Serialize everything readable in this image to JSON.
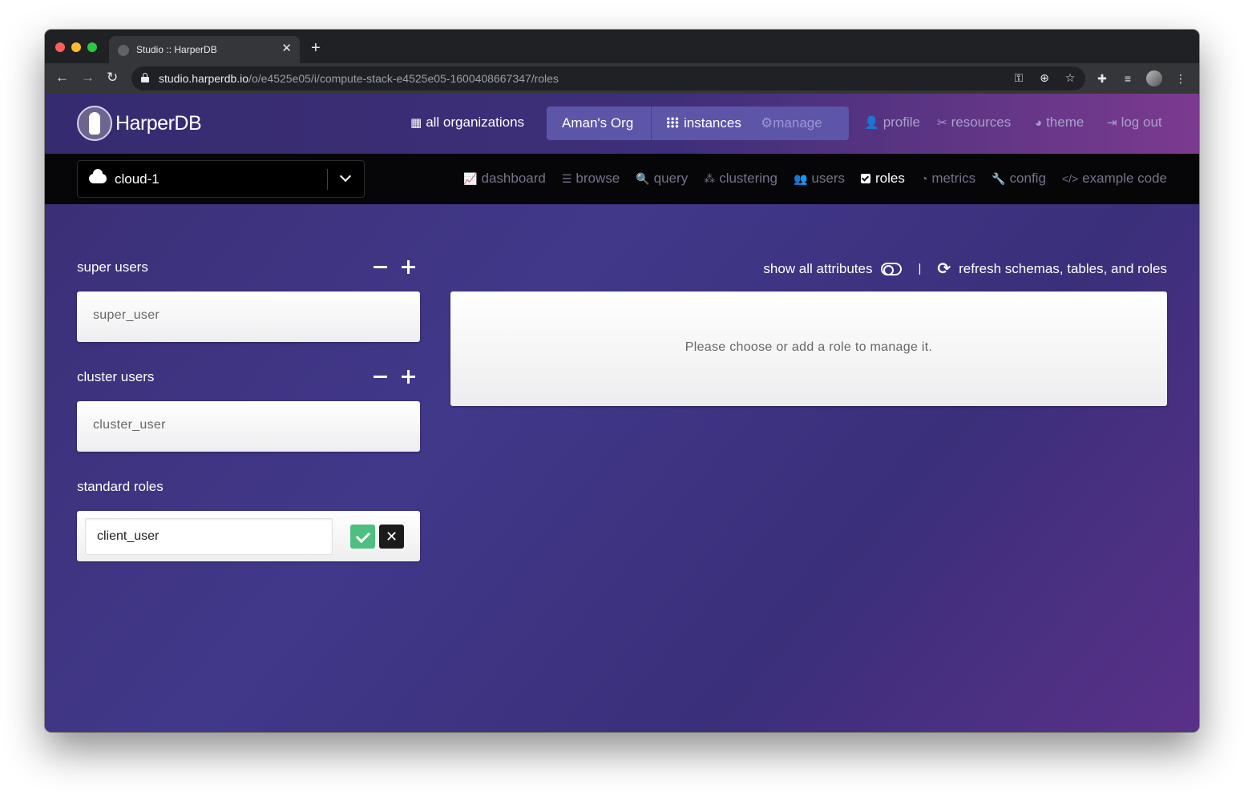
{
  "browser": {
    "tab_title": "Studio :: HarperDB",
    "tab_close": "✕",
    "new_tab": "+",
    "url_host": "studio.harperdb.io",
    "url_path": "/o/e4525e05/i/compute-stack-e4525e05-1600408667347/roles"
  },
  "header": {
    "logo_text": "HarperDB",
    "all_orgs": "all organizations",
    "org_name": "Aman's Org",
    "instances": "instances",
    "manage": "manage",
    "profile": "profile",
    "resources": "resources",
    "theme": "theme",
    "logout": "log out"
  },
  "instance": {
    "name": "cloud-1"
  },
  "tabs": [
    {
      "label": "dashboard",
      "icon": "chart-line-icon",
      "glyph": "📈"
    },
    {
      "label": "browse",
      "icon": "list-icon",
      "glyph": "☰"
    },
    {
      "label": "query",
      "icon": "search-icon",
      "glyph": "🔍"
    },
    {
      "label": "clustering",
      "icon": "cubes-icon",
      "glyph": "⁂"
    },
    {
      "label": "users",
      "icon": "users-icon",
      "glyph": "👥"
    },
    {
      "label": "roles",
      "icon": "check-square-icon",
      "glyph": ""
    },
    {
      "label": "metrics",
      "icon": "gauge-icon",
      "glyph": "◔"
    },
    {
      "label": "config",
      "icon": "wrench-icon",
      "glyph": "🔧"
    },
    {
      "label": "example code",
      "icon": "code-icon",
      "glyph": "</>"
    }
  ],
  "active_tab": "roles",
  "roles": {
    "super_title": "super users",
    "super_items": [
      "super_user"
    ],
    "cluster_title": "cluster users",
    "cluster_items": [
      "cluster_user"
    ],
    "standard_title": "standard roles",
    "new_role_value": "client_user",
    "cancel_label": "✕"
  },
  "toolbar": {
    "show_attributes": "show all attributes",
    "separator": "|",
    "refresh": "refresh schemas, tables, and roles"
  },
  "message": "Please choose or add a role to manage it."
}
